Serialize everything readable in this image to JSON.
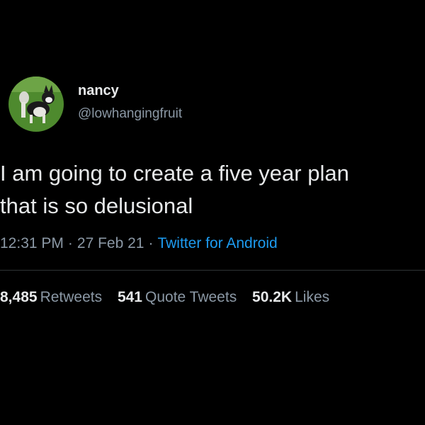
{
  "author": {
    "name": "nancy",
    "handle": "@lowhangingfruit",
    "avatar_icon": "dog-photo-avatar"
  },
  "tweet": {
    "lines": [
      "I am going to create a five year plan",
      "that is so delusional"
    ],
    "time": "12:31 PM",
    "date": "27 Feb 21",
    "source": "Twitter for Android"
  },
  "stats": {
    "retweets_value": "8,485",
    "retweets_label": "Retweets",
    "quotes_value": "541",
    "quotes_label": "Quote Tweets",
    "likes_value": "50.2K",
    "likes_label": "Likes"
  },
  "colors": {
    "background": "#000000",
    "text": "#e7e9ea",
    "secondary": "#8b98a5",
    "link": "#1d9bf0"
  }
}
